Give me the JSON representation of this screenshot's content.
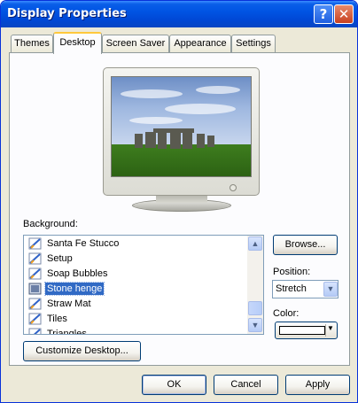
{
  "window": {
    "title": "Display Properties"
  },
  "titlebar": {
    "help_glyph": "?",
    "close_glyph": "✕"
  },
  "tabs": [
    {
      "label": "Themes"
    },
    {
      "label": "Desktop"
    },
    {
      "label": "Screen Saver"
    },
    {
      "label": "Appearance"
    },
    {
      "label": "Settings"
    }
  ],
  "active_tab": "Desktop",
  "preview": {
    "image": "stonehenge-wallpaper"
  },
  "background": {
    "label": "Background:",
    "items": [
      {
        "label": "Santa Fe Stucco",
        "icon": "bitmap-icon"
      },
      {
        "label": "Setup",
        "icon": "bitmap-icon"
      },
      {
        "label": "Soap Bubbles",
        "icon": "bitmap-icon"
      },
      {
        "label": "Stone henge",
        "icon": "jpeg-icon"
      },
      {
        "label": "Straw Mat",
        "icon": "bitmap-icon"
      },
      {
        "label": "Tiles",
        "icon": "bitmap-icon"
      },
      {
        "label": "Triangles",
        "icon": "bitmap-icon"
      }
    ],
    "selected": "Stone henge"
  },
  "browse": {
    "label": "Browse..."
  },
  "position": {
    "label": "Position:",
    "value": "Stretch"
  },
  "color": {
    "label": "Color:",
    "value": "#ffffff"
  },
  "customize": {
    "label": "Customize Desktop..."
  },
  "footer": {
    "ok": "OK",
    "cancel": "Cancel",
    "apply": "Apply"
  },
  "colors": {
    "titlebar": "#0054e3",
    "selection": "#316ac5",
    "tab_highlight": "#ffc83c",
    "dialog": "#ece9d8"
  }
}
